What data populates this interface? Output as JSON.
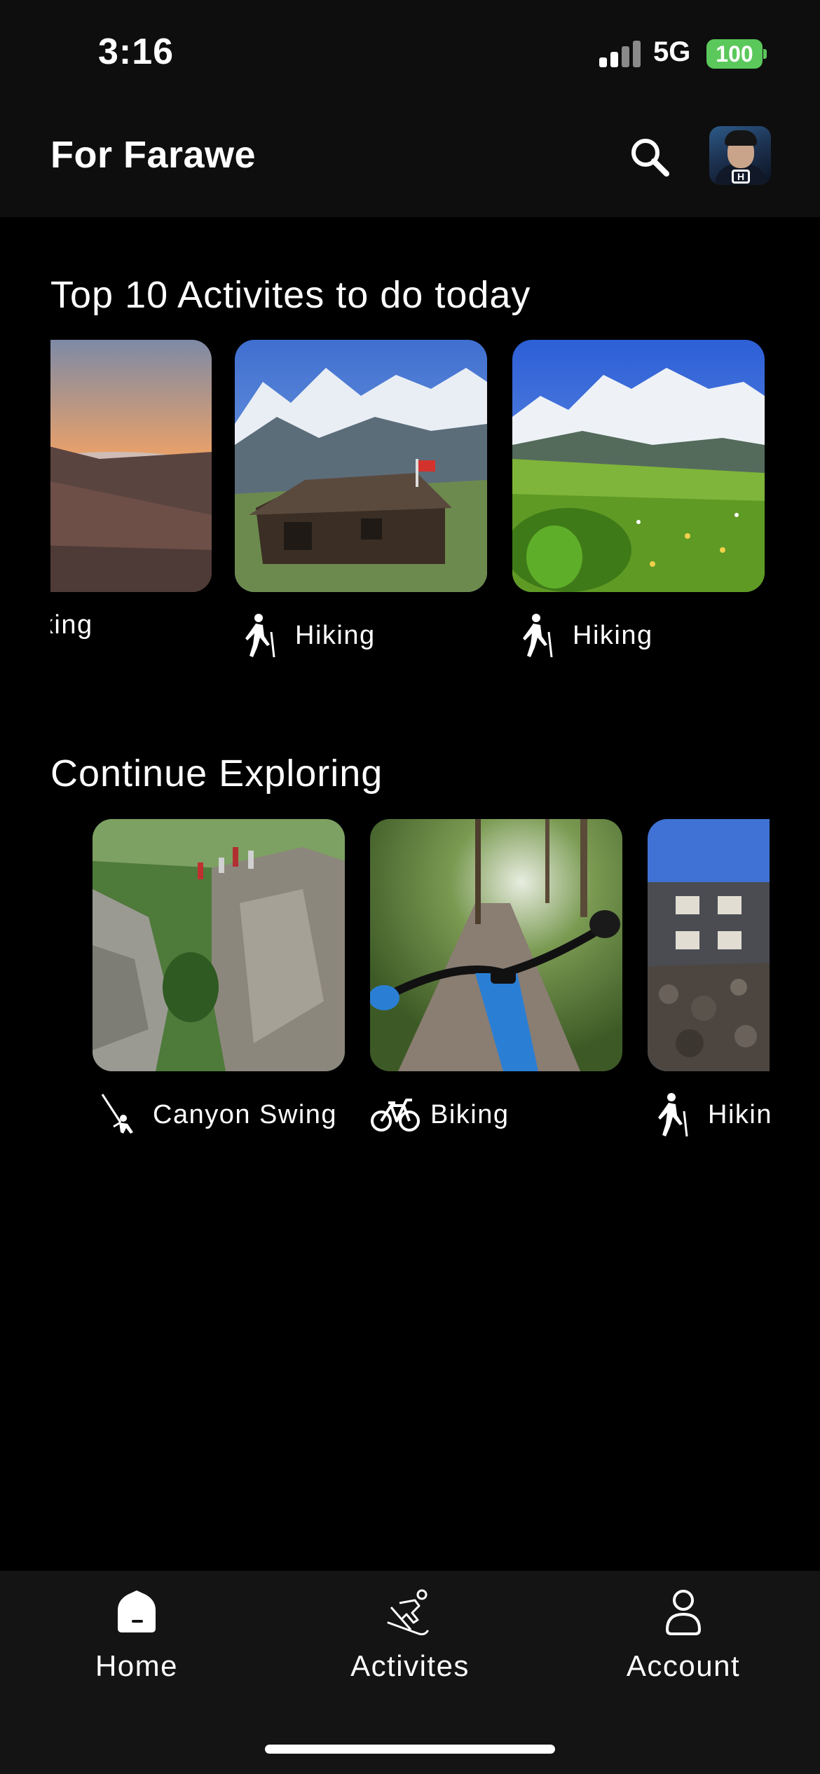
{
  "status_bar": {
    "time": "3:16",
    "network": "5G",
    "battery": "100"
  },
  "header": {
    "title": "For Farawe",
    "search_icon": "search-icon",
    "avatar_icon": "user-avatar"
  },
  "top_activities": {
    "title": "Top 10 Activites to do today",
    "items": [
      {
        "label": "Hiking",
        "icon": "hiker-icon",
        "visible_label": "king"
      },
      {
        "label": "Hiking",
        "icon": "hiker-icon"
      },
      {
        "label": "Hiking",
        "icon": "hiker-icon"
      }
    ]
  },
  "continue_exploring": {
    "title": "Continue Exploring",
    "items": [
      {
        "label": "Canyon Swing",
        "icon": "canyon-swing-icon"
      },
      {
        "label": "Biking",
        "icon": "bicycle-icon"
      },
      {
        "label": "Hiking",
        "icon": "hiker-icon",
        "visible_label": "Hikir"
      }
    ]
  },
  "tab_bar": {
    "items": [
      {
        "label": "Home",
        "icon": "home-icon",
        "active": true
      },
      {
        "label": "Activites",
        "icon": "skier-icon",
        "active": false
      },
      {
        "label": "Account",
        "icon": "account-icon",
        "active": false
      }
    ]
  },
  "colors": {
    "background": "#000000",
    "header_bg": "#0e0e0e",
    "tabbar_bg": "#141414",
    "battery": "#5bc85b",
    "text": "#ffffff"
  }
}
